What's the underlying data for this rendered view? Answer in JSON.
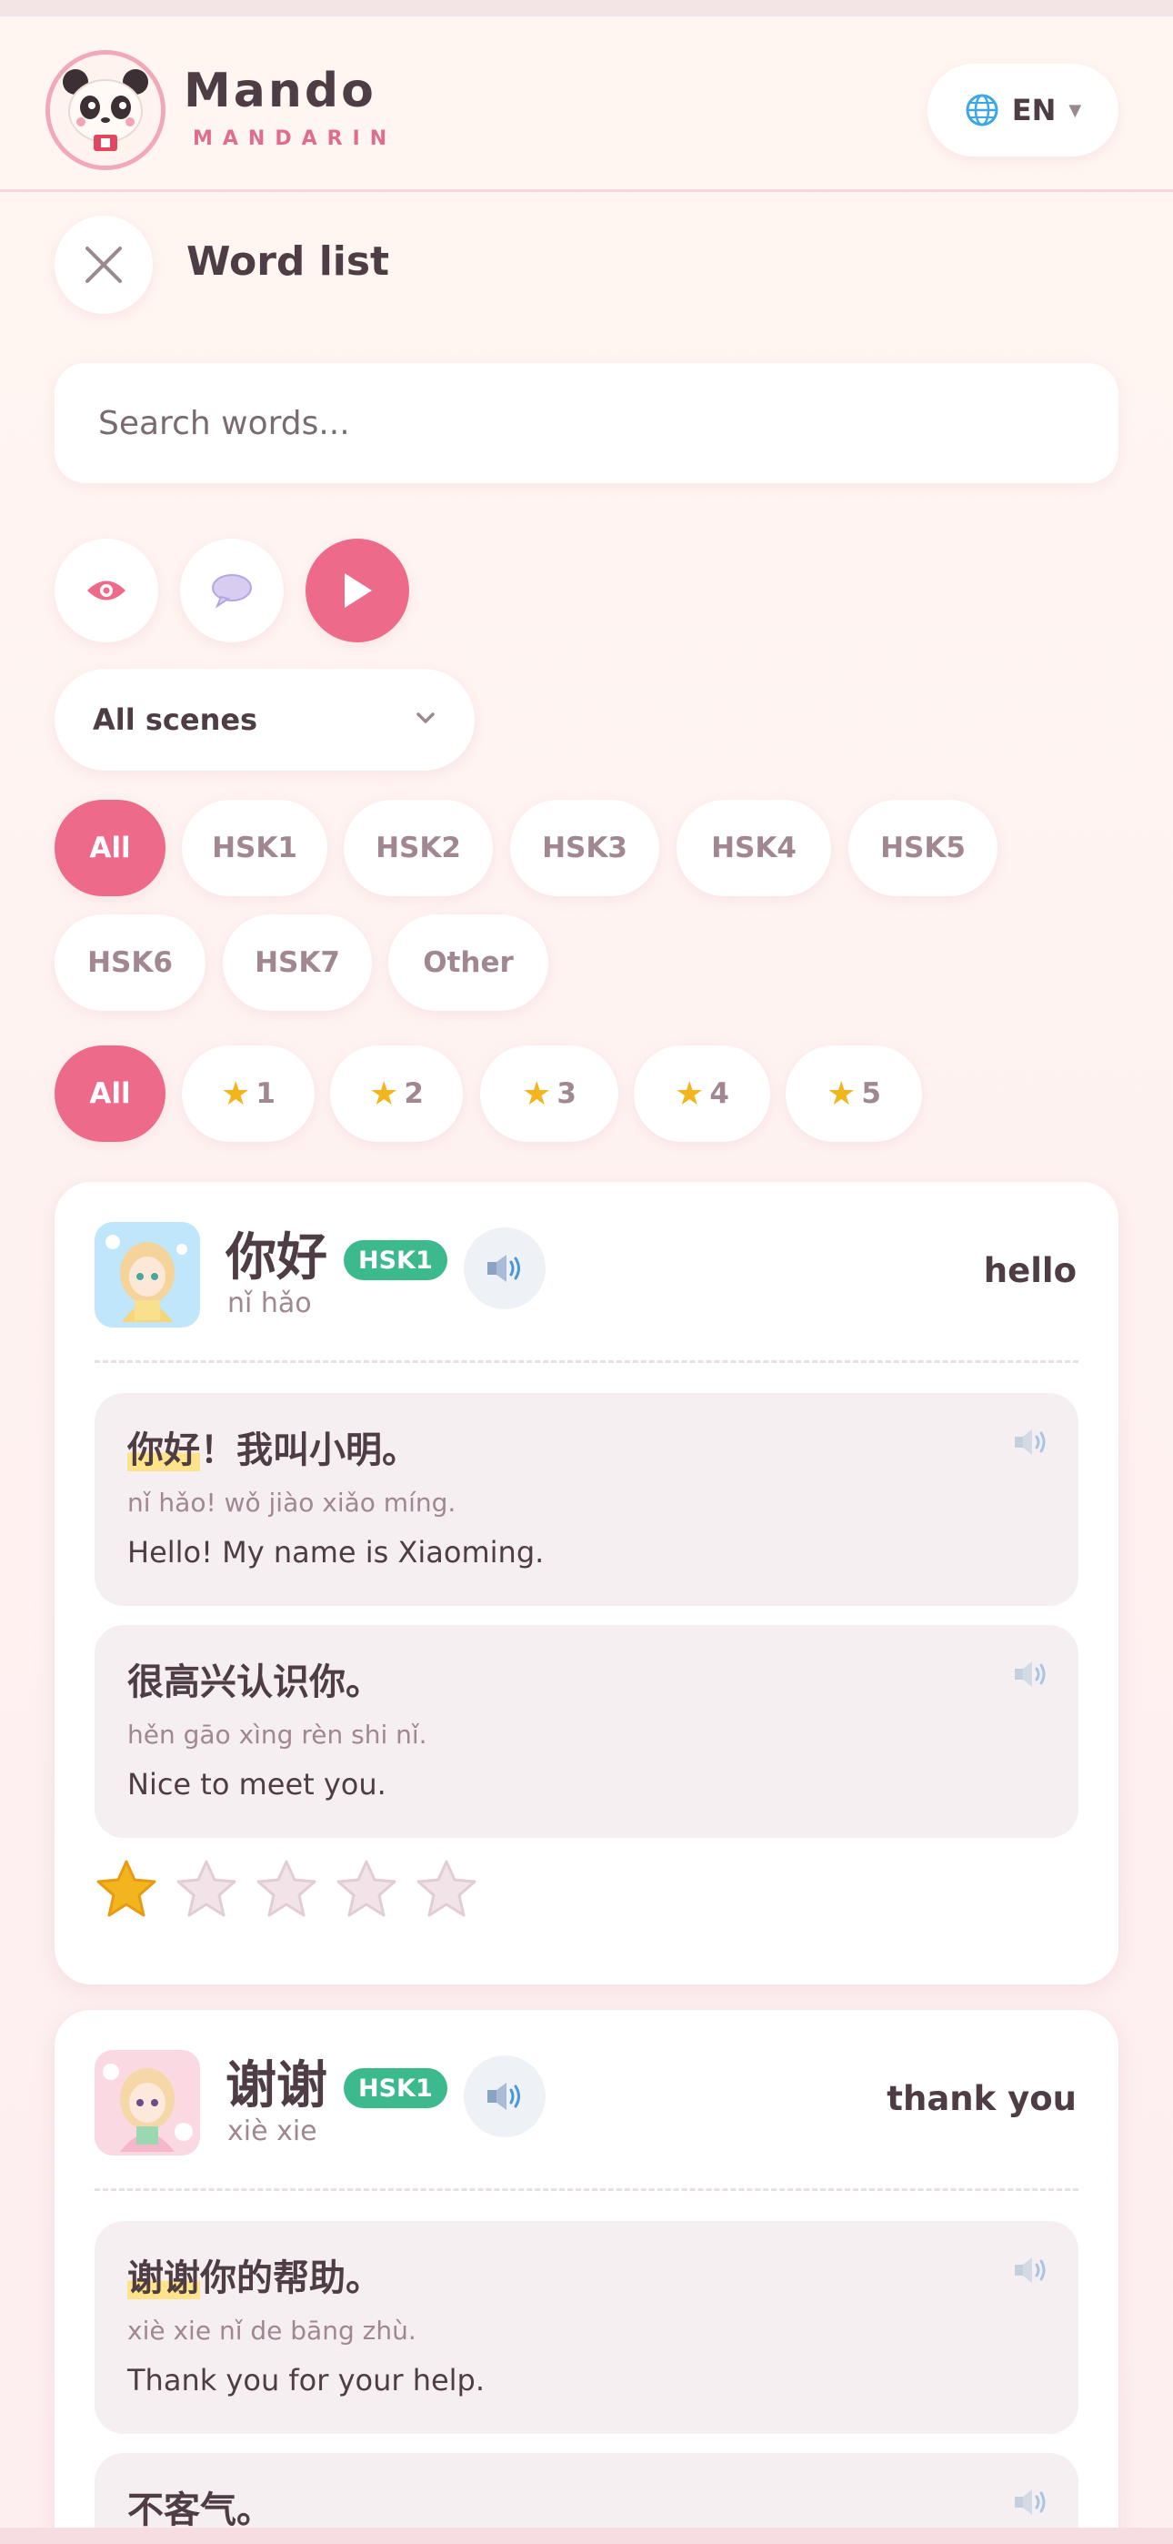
{
  "header": {
    "brand_name": "Mando",
    "brand_sub": "MANDARIN",
    "language": "EN",
    "logo_icon": "panda-avatar-icon"
  },
  "page": {
    "title": "Word list"
  },
  "search": {
    "placeholder": "Search words..."
  },
  "tools": {
    "eye_icon": "eye-icon",
    "speech_icon": "speech-bubble-icon",
    "play_icon": "play-icon"
  },
  "scene_filter": {
    "selected": "All scenes"
  },
  "level_filters": [
    "All",
    "HSK1",
    "HSK2",
    "HSK3",
    "HSK4",
    "HSK5",
    "HSK6",
    "HSK7",
    "Other"
  ],
  "star_filters": [
    "All",
    "1",
    "2",
    "3",
    "4",
    "5"
  ],
  "colors": {
    "accent": "#ee6a8a",
    "hsk_badge": "#3cb98d",
    "text": "#4e3d44",
    "muted": "#a08792",
    "star": "#f2b51e"
  },
  "words": [
    {
      "hanzi": "你好",
      "level": "HSK1",
      "pinyin": "nǐ hǎo",
      "meaning": "hello",
      "rating": 1,
      "examples": [
        {
          "highlight": "你好",
          "rest": "！我叫小明。",
          "pinyin": "nǐ hǎo! wǒ jiào xiǎo míng.",
          "english": "Hello! My name is Xiaoming."
        },
        {
          "highlight": "",
          "rest": "很高兴认识你。",
          "pinyin": "hěn gāo xìng rèn shi nǐ.",
          "english": "Nice to meet you."
        }
      ]
    },
    {
      "hanzi": "谢谢",
      "level": "HSK1",
      "pinyin": "xiè xie",
      "meaning": "thank you",
      "rating": 0,
      "examples": [
        {
          "highlight": "谢谢",
          "rest": "你的帮助。",
          "pinyin": "xiè xie nǐ de bāng zhù.",
          "english": "Thank you for your help."
        },
        {
          "highlight": "",
          "rest": "不客气。",
          "pinyin": "",
          "english": ""
        }
      ]
    }
  ]
}
